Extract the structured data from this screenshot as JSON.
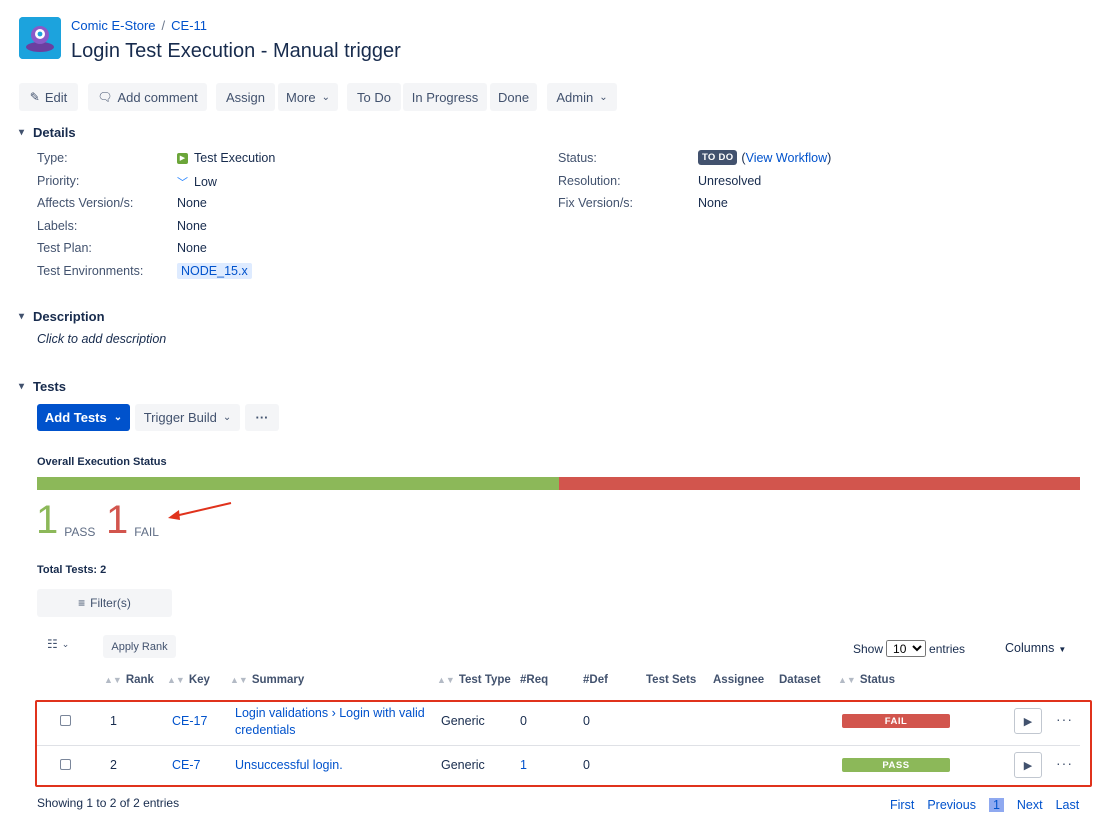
{
  "breadcrumb": {
    "project": "Comic E-Store",
    "separator": "/",
    "issue_key": "CE-11"
  },
  "page_title": "Login Test Execution - Manual trigger",
  "toolbar": {
    "edit": "Edit",
    "add_comment": "Add comment",
    "assign": "Assign",
    "more": "More",
    "to_do": "To Do",
    "in_progress": "In Progress",
    "done": "Done",
    "admin": "Admin"
  },
  "details": {
    "heading": "Details",
    "left": [
      {
        "label": "Type:",
        "value": "Test Execution"
      },
      {
        "label": "Priority:",
        "value": "Low"
      },
      {
        "label": "Affects Version/s:",
        "value": "None"
      },
      {
        "label": "Labels:",
        "value": "None"
      },
      {
        "label": "Test Plan:",
        "value": "None"
      },
      {
        "label": "Test Environments:",
        "value": "NODE_15.x"
      }
    ],
    "right": [
      {
        "label": "Status:",
        "badge": "TO DO",
        "paren_open": "(",
        "link": "View Workflow",
        "paren_close": ")"
      },
      {
        "label": "Resolution:",
        "value": "Unresolved"
      },
      {
        "label": "Fix Version/s:",
        "value": "None"
      }
    ]
  },
  "description": {
    "heading": "Description",
    "placeholder": "Click to add description"
  },
  "tests": {
    "heading": "Tests",
    "add_tests": "Add Tests",
    "trigger_build": "Trigger Build",
    "more_dots": "···",
    "overall_status_label": "Overall Execution Status",
    "progress": {
      "pass_fraction": 0.5,
      "fail_fraction": 0.5
    },
    "pass_count": "1",
    "pass_label": "PASS",
    "fail_count": "1",
    "fail_label": "FAIL",
    "total_tests": "Total Tests: 2",
    "filter_button": "Filter(s)",
    "apply_rank": "Apply Rank",
    "show_label": "Show",
    "entries_value": "10",
    "entries_label": "entries",
    "columns_label": "Columns",
    "headers": {
      "rank": "Rank",
      "key": "Key",
      "summary": "Summary",
      "test_type": "Test Type",
      "req": "#Req",
      "def": "#Def",
      "test_sets": "Test Sets",
      "assignee": "Assignee",
      "dataset": "Dataset",
      "status": "Status"
    },
    "rows": [
      {
        "rank": "1",
        "key": "CE-17",
        "summary_line1": "Login validations › Login with valid",
        "summary_line2": "credentials",
        "test_type": "Generic",
        "req": "0",
        "def": "0",
        "status": "FAIL",
        "status_color": "#d2554d"
      },
      {
        "rank": "2",
        "key": "CE-7",
        "summary_line1": "Unsuccessful login.",
        "summary_line2": "",
        "test_type": "Generic",
        "req": "1",
        "def": "0",
        "status": "PASS",
        "status_color": "#8cb859"
      }
    ],
    "footer_info": "Showing 1 to 2 of 2 entries",
    "pagination": {
      "first": "First",
      "previous": "Previous",
      "current": "1",
      "next": "Next",
      "last": "Last"
    }
  },
  "colors": {
    "pass": "#8cb859",
    "fail": "#d2554d",
    "link": "#0052cc",
    "primary": "#0052cc",
    "annotation_red": "#e0321c"
  }
}
